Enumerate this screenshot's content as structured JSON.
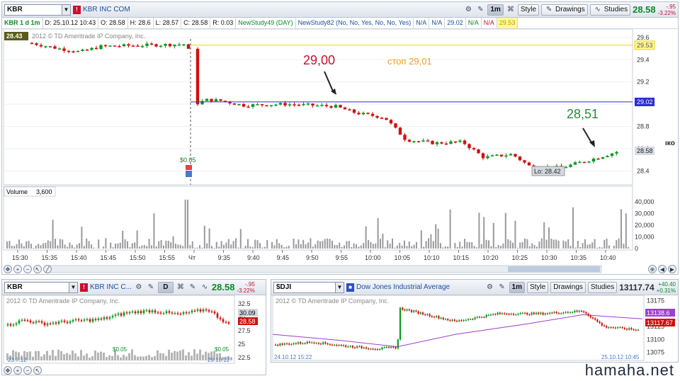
{
  "main": {
    "symbol": "KBR",
    "company": "KBR INC COM",
    "interval": "1m",
    "style_label": "Style",
    "drawings_label": "Drawings",
    "studies_label": "Studies",
    "last_price": "28.58",
    "change": "-.95",
    "change_pct": "-3.22%",
    "info": {
      "series": "KBR 1 d 1m",
      "date": "D: 25.10.12 10:43",
      "open": "O: 28.58",
      "high": "H: 28.6",
      "low": "L: 28.57",
      "close": "C: 28.58",
      "range": "R: 0.03",
      "study1": "NewStudy49 (DAY)",
      "study2": "NewStudy82 (No, No, Yes, No, No, Yes)",
      "na1": "N/A",
      "na2": "N/A",
      "v1": "29.02",
      "na3": "N/A",
      "na4": "N/A",
      "v2": "29.53"
    },
    "copyright": "2012 © TD Ameritrade IP Company, Inc.",
    "left_price_tag": "28.43",
    "price_axis": [
      "29.6",
      "29.4",
      "29.2",
      "29",
      "28.8",
      "28.6",
      "28.4"
    ],
    "tags": {
      "yellow_line": "29.53",
      "blue_line": "29.02",
      "last": "28.58"
    },
    "annotations": {
      "entry": "29,00",
      "stop": "стоп 29,01",
      "target": "28,51",
      "low_label": "Lo: 28.42",
      "dividend": "$0.05"
    },
    "volume_label": "Volume",
    "volume_value": "3,600",
    "volume_axis": [
      "40,000",
      "30,000",
      "20,000",
      "10,000",
      "0"
    ],
    "time_axis": [
      "15:30",
      "15:35",
      "15:40",
      "15:45",
      "15:50",
      "15:55",
      "Чт",
      "9:35",
      "9:40",
      "9:45",
      "9:50",
      "9:55",
      "10:00",
      "10:05",
      "10:10",
      "10:15",
      "10:20",
      "10:25",
      "10:30",
      "10:35",
      "10:40"
    ],
    "right_edge_text": "ıкo"
  },
  "left_sub": {
    "symbol": "KBR",
    "company": "KBR INC C...",
    "interval": "D",
    "last_price": "28.58",
    "change": "-.95",
    "change_pct": "-3.22%",
    "copyright": "2012 © TD Ameritrade IP Company, Inc.",
    "price_axis": [
      "32.5",
      "30",
      "27.5",
      "25",
      "22.5"
    ],
    "tags": {
      "a": "30.09",
      "b": "28.58"
    },
    "labels": {
      "d1": "$0.05",
      "d2": "$0.05",
      "date": "29.10.12",
      "date2": "23.7.12"
    }
  },
  "right_sub": {
    "symbol": "$DJI",
    "company": "Dow Jones Industrial Average",
    "interval": "1m",
    "style_label": "Style",
    "drawings_label": "Drawings",
    "studies_label": "Studies",
    "last_price": "13117.74",
    "change": "+40.40",
    "change_pct": "+0.31%",
    "copyright": "2012 © TD Ameritrade IP Company, Inc.",
    "price_axis": [
      "13175",
      "13150",
      "13125",
      "13100",
      "13075"
    ],
    "tags": {
      "a": "13138.6",
      "b": "13117.67"
    },
    "labels": {
      "start": "24.10.12 15:22",
      "end": "25.10.12 10:45"
    }
  },
  "watermark": "hamaha.net",
  "colors": {
    "up": "#0a9a1e",
    "down": "#d01010",
    "blue_line": "#2b2bd6",
    "yellow_line": "#e8d800",
    "volume": "#9a9a9a",
    "ma": "#9b3fd0"
  }
}
